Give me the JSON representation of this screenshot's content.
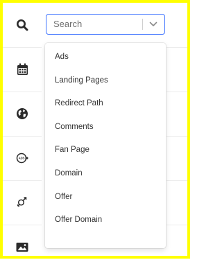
{
  "search": {
    "placeholder": "Search",
    "value": ""
  },
  "dropdown": {
    "options": [
      "Ads",
      "Landing Pages",
      "Redirect Path",
      "Comments",
      "Fan Page",
      "Domain",
      "Offer",
      "Offer Domain"
    ]
  },
  "sidebar": {
    "icons": [
      "search-icon",
      "calendar-icon",
      "globe-icon",
      "ad-icon",
      "gender-icon",
      "image-icon"
    ]
  },
  "colors": {
    "frame_border": "#ffff00",
    "focus_border": "#3f74ff",
    "icon": "#2b2b2b"
  }
}
